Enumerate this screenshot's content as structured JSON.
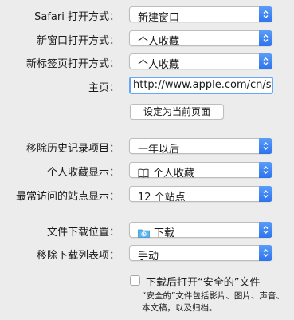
{
  "settings": {
    "open_with": {
      "label": "Safari 打开方式：",
      "value": "新建窗口"
    },
    "new_window": {
      "label": "新窗口打开方式：",
      "value": "个人收藏"
    },
    "new_tab": {
      "label": "新标签页打开方式：",
      "value": "个人收藏"
    },
    "homepage": {
      "label": "主页：",
      "value": "http://www.apple.com/cn/st"
    },
    "set_current_button": "设定为当前页面",
    "remove_history": {
      "label": "移除历史记录项目：",
      "value": "一年以后"
    },
    "favorites_shows": {
      "label": "个人收藏显示：",
      "value": "个人收藏",
      "icon": "book-icon"
    },
    "top_sites": {
      "label": "最常访问的站点显示：",
      "value": "12 个站点"
    },
    "download_location": {
      "label": "文件下载位置：",
      "value": "下载",
      "icon": "downloads-folder-icon"
    },
    "remove_downloads": {
      "label": "移除下载列表项：",
      "value": "手动"
    },
    "open_safe_files": {
      "label": "下载后打开“安全的”文件",
      "checked": false,
      "note_line1": "“安全的”文件包括影片、图片、声音、",
      "note_line2": "本文稿，以及归档。"
    }
  },
  "colors": {
    "accent": "#2d73ee",
    "focus_ring": "#6aa6f6",
    "window_bg": "#ececec"
  }
}
